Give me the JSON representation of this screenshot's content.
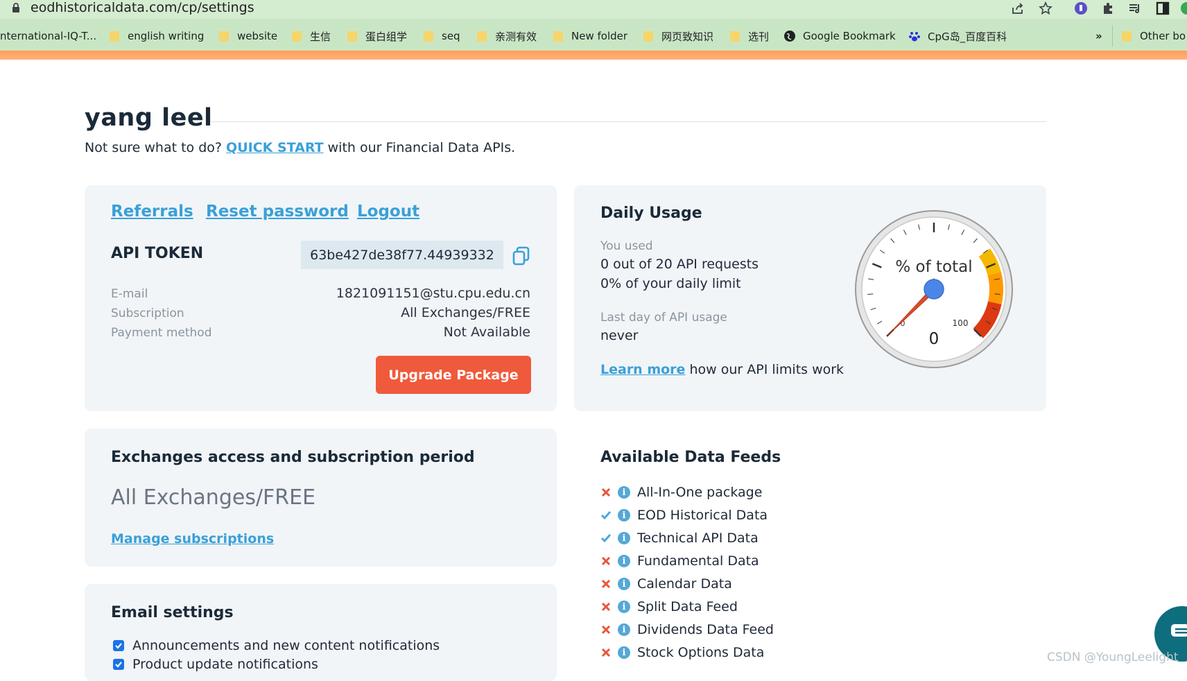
{
  "browser": {
    "url": "eodhistoricaldata.com/cp/settings",
    "bookmarks": [
      {
        "label": "nternational-IQ-T...",
        "icon": "none"
      },
      {
        "label": "english writing",
        "icon": "folder"
      },
      {
        "label": "website",
        "icon": "folder"
      },
      {
        "label": "生信",
        "icon": "folder"
      },
      {
        "label": "蛋白组学",
        "icon": "folder"
      },
      {
        "label": "seq",
        "icon": "folder"
      },
      {
        "label": "亲测有效",
        "icon": "folder"
      },
      {
        "label": "New folder",
        "icon": "folder"
      },
      {
        "label": "网页致知识",
        "icon": "folder"
      },
      {
        "label": "选刊",
        "icon": "folder"
      },
      {
        "label": "Google Bookmark",
        "icon": "globe"
      },
      {
        "label": "CpG岛_百度百科",
        "icon": "baidu-paw"
      }
    ],
    "overflow_label": "»",
    "other_bookmarks": "Other bo"
  },
  "header": {
    "user_name": "yang leel",
    "quick_prefix": "Not sure what to do?",
    "quick_link": "QUICK START",
    "quick_suffix": "with our Financial Data APIs."
  },
  "account": {
    "links": [
      "Referrals",
      "Reset password",
      "Logout"
    ],
    "api_token_label": "API TOKEN",
    "api_token": "63be427de38f77.44939332",
    "rows": [
      {
        "label": "E-mail",
        "value": "1821091151@stu.cpu.edu.cn"
      },
      {
        "label": "Subscription",
        "value": "All Exchanges/FREE"
      },
      {
        "label": "Payment method",
        "value": "Not Available"
      }
    ],
    "upgrade_label": "Upgrade Package"
  },
  "usage": {
    "title": "Daily Usage",
    "you_used_label": "You used",
    "requests_text": "0 out of 20 API requests",
    "percent_text": "0% of your daily limit",
    "last_day_label": "Last day of API usage",
    "last_day_value": "never",
    "learn_more_link": "Learn more",
    "learn_more_suffix": "how our API limits work",
    "gauge": {
      "label": "% of total",
      "value_text": "0",
      "value": 0,
      "min_label": "0",
      "max_label": "100",
      "band_colors": [
        "#f5b800",
        "#ff9900",
        "#dc3912"
      ]
    }
  },
  "exchanges": {
    "title": "Exchanges access and subscription period",
    "plan": "All Exchanges/FREE",
    "manage_link": "Manage subscriptions"
  },
  "feeds": {
    "title": "Available Data Feeds",
    "items": [
      {
        "label": "All-In-One package",
        "available": false
      },
      {
        "label": "EOD Historical Data",
        "available": true
      },
      {
        "label": "Technical API Data",
        "available": true
      },
      {
        "label": "Fundamental Data",
        "available": false
      },
      {
        "label": "Calendar Data",
        "available": false
      },
      {
        "label": "Split Data Feed",
        "available": false
      },
      {
        "label": "Dividends Data Feed",
        "available": false
      },
      {
        "label": "Stock Options Data",
        "available": false
      }
    ]
  },
  "email_settings": {
    "title": "Email settings",
    "options": [
      {
        "label": "Announcements and new content notifications",
        "checked": true
      },
      {
        "label": "Product update notifications",
        "checked": true
      }
    ]
  },
  "watermark": "CSDN @YoungLeelight",
  "colors": {
    "accent": "#3aa0d8",
    "button": "#ef5a3c",
    "card": "#f1f5f8"
  }
}
